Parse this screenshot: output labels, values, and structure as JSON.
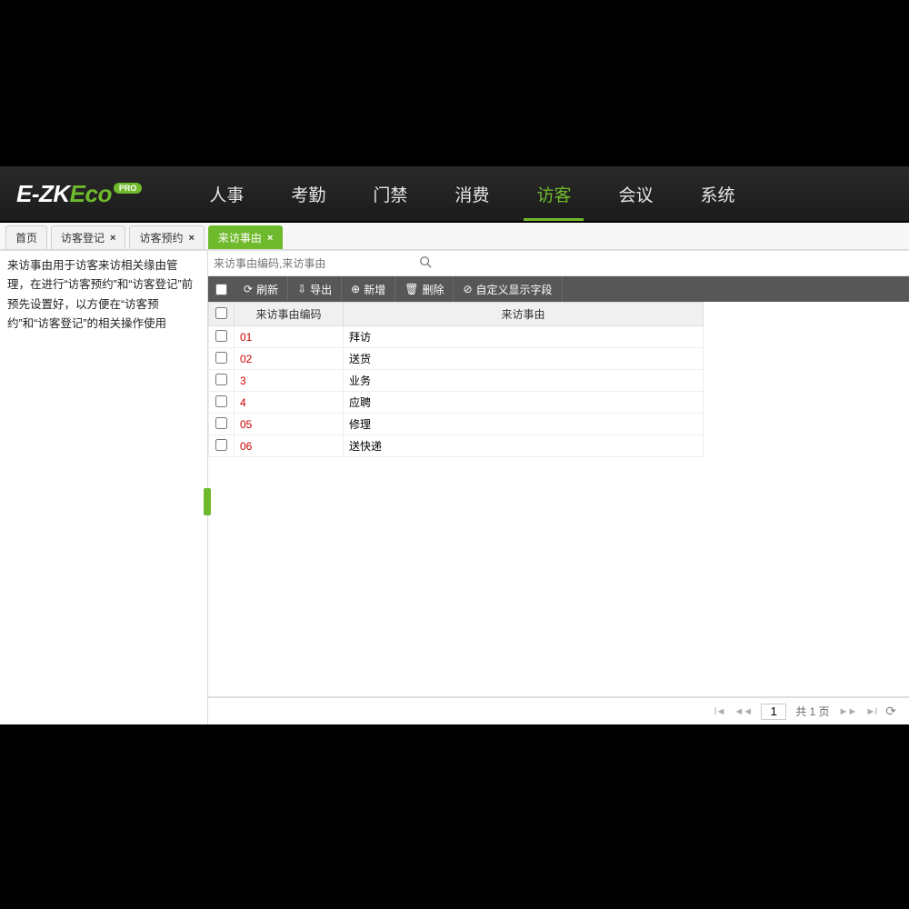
{
  "logo": {
    "prefix": "E-ZK",
    "eco": "Eco",
    "badge": "PRO"
  },
  "nav": {
    "items": [
      "人事",
      "考勤",
      "门禁",
      "消费",
      "访客",
      "会议",
      "系统"
    ],
    "active_index": 4
  },
  "tabs": [
    {
      "label": "首页",
      "closable": false
    },
    {
      "label": "访客登记",
      "closable": true
    },
    {
      "label": "访客预约",
      "closable": true
    },
    {
      "label": "来访事由",
      "closable": true,
      "active": true
    }
  ],
  "sidebar": {
    "desc": "来访事由用于访客来访相关缘由管理，在进行“访客预约”和“访客登记”前预先设置好，以方便在“访客预约”和“访客登记”的相关操作使用"
  },
  "search": {
    "placeholder": "来访事由编码,来访事由"
  },
  "toolbar": {
    "refresh": "刷新",
    "export": "导出",
    "add": "新增",
    "delete": "删除",
    "custom_fields": "自定义显示字段"
  },
  "table": {
    "headers": {
      "code": "来访事由编码",
      "reason": "来访事由"
    },
    "rows": [
      {
        "code": "01",
        "reason": "拜访"
      },
      {
        "code": "02",
        "reason": "送货"
      },
      {
        "code": "3",
        "reason": "业务"
      },
      {
        "code": "4",
        "reason": "应聘"
      },
      {
        "code": "05",
        "reason": "修理"
      },
      {
        "code": "06",
        "reason": "送快递"
      }
    ]
  },
  "pager": {
    "page": "1",
    "total_text": "共 1 页"
  }
}
